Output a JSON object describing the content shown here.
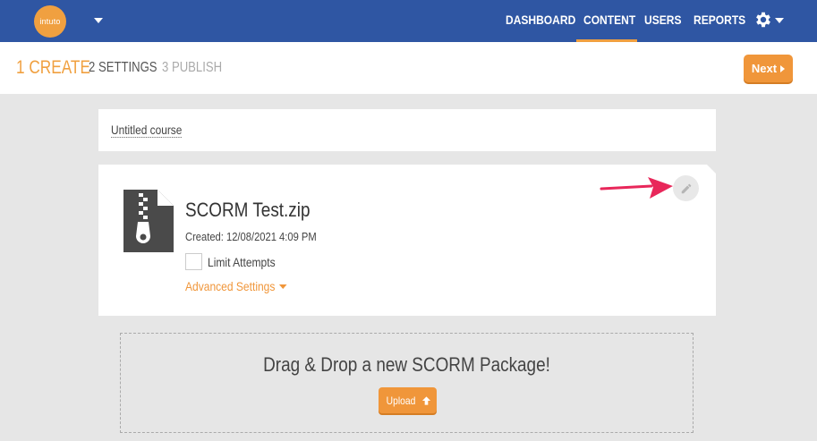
{
  "brand": {
    "logo_text": "intuto"
  },
  "nav": {
    "items": [
      {
        "label": "DASHBOARD",
        "active": false
      },
      {
        "label": "CONTENT",
        "active": true
      },
      {
        "label": "USERS",
        "active": false
      },
      {
        "label": "REPORTS",
        "active": false
      }
    ],
    "settings_icon": "gear-icon",
    "active_color": "#f0a040"
  },
  "steps": {
    "step1": "1 CREATE",
    "step2": "2 SETTINGS",
    "step3": "3 PUBLISH",
    "next_label": "Next"
  },
  "course": {
    "title": "Untitled course"
  },
  "file": {
    "icon": "zip-file-icon",
    "name": "SCORM Test.zip",
    "created": "Created: 12/08/2021 4:09 PM",
    "limit_attempts_label": "Limit Attempts",
    "limit_attempts_checked": false,
    "advanced_settings_label": "Advanced Settings",
    "edit_icon": "pencil-icon"
  },
  "dropzone": {
    "text": "Drag & Drop a new SCORM Package!",
    "upload_label": "Upload",
    "upload_icon": "arrow-up-icon"
  },
  "colors": {
    "header": "#2f56a3",
    "accent": "#f0963a",
    "annotation_arrow": "#e8275a"
  }
}
